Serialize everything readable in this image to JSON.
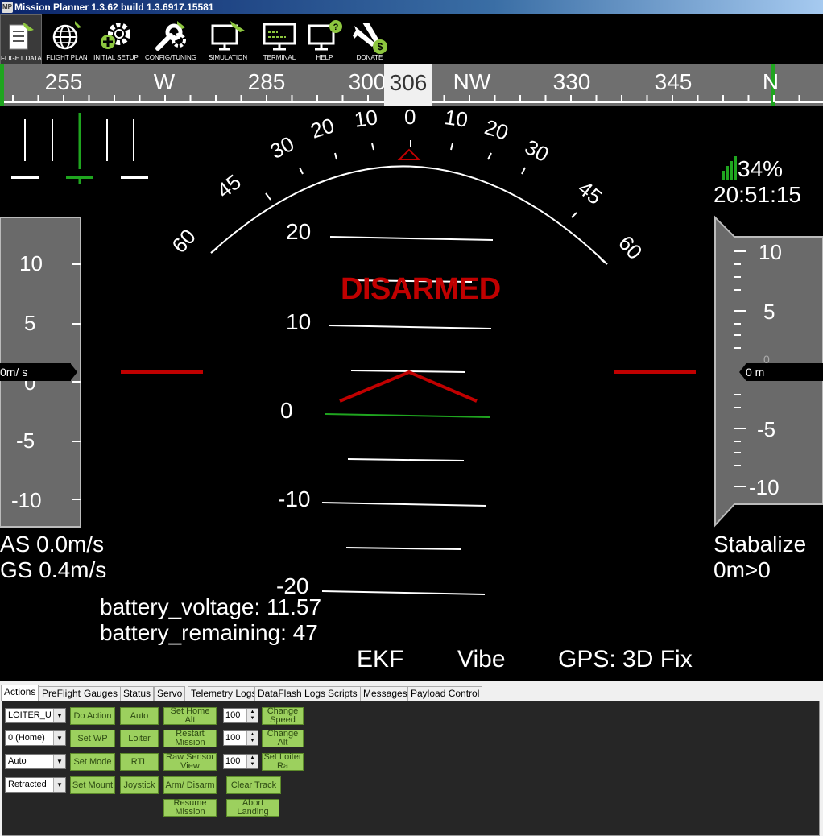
{
  "window": {
    "title": "Mission Planner 1.3.62 build 1.3.6917.15581"
  },
  "toolbar": [
    {
      "label": "FLIGHT DATA",
      "icon": "flight-data-icon"
    },
    {
      "label": "FLIGHT PLAN",
      "icon": "flight-plan-icon"
    },
    {
      "label": "INITIAL SETUP",
      "icon": "initial-setup-icon"
    },
    {
      "label": "CONFIG/TUNING",
      "icon": "config-tuning-icon"
    },
    {
      "label": "SIMULATION",
      "icon": "simulation-icon"
    },
    {
      "label": "TERMINAL",
      "icon": "terminal-icon"
    },
    {
      "label": "HELP",
      "icon": "help-icon"
    },
    {
      "label": "DONATE",
      "icon": "donate-icon"
    }
  ],
  "heading": {
    "labels": [
      "255",
      "W",
      "285",
      "300",
      "NW",
      "330",
      "345",
      "N"
    ],
    "current": "306"
  },
  "hud": {
    "roll_scale": [
      "60",
      "45",
      "30",
      "20",
      "10",
      "0",
      "10",
      "20",
      "30",
      "45",
      "60"
    ],
    "pitch_scale": [
      "20",
      "10",
      "0",
      "-10",
      "-20"
    ],
    "status": "DISARMED",
    "battery_pct": "34%",
    "clock": "20:51:15",
    "speed_scale": [
      "10",
      "5",
      "0",
      "-5",
      "-10"
    ],
    "speed_readout": "0m/ s",
    "alt_scale": [
      "10",
      "5",
      "0",
      "-5",
      "-10"
    ],
    "alt_readout": "0 m",
    "airspeed": "AS 0.0m/s",
    "groundspeed": "GS 0.4m/s",
    "battery_voltage": "battery_voltage: 11.57",
    "battery_remaining": "battery_remaining: 47",
    "mode": "Stabalize",
    "wp_dist": "0m>0",
    "ekf": "EKF",
    "vibe": "Vibe",
    "gps": "GPS: 3D Fix"
  },
  "tabs": [
    "Actions",
    "PreFlight",
    "Gauges",
    "Status",
    "Servo",
    "Telemetry Logs",
    "DataFlash Logs",
    "Scripts",
    "Messages",
    "Payload Control"
  ],
  "actions": {
    "combos": [
      "LOITER_U",
      "0 (Home)",
      "Auto",
      "Retracted"
    ],
    "buttons": {
      "do_action": "Do Action",
      "auto": "Auto",
      "set_home_alt": "Set Home Alt",
      "change_speed": "Change Speed",
      "set_wp": "Set WP",
      "loiter": "Loiter",
      "restart_mission": "Restart Mission",
      "change_alt": "Change Alt",
      "set_mode": "Set Mode",
      "rtl": "RTL",
      "raw_sensor_view": "Raw Sensor View",
      "set_loiter_rad": "Set Loiter Ra",
      "set_mount": "Set Mount",
      "joystick": "Joystick",
      "arm_disarm": "Arm/ Disarm",
      "clear_track": "Clear Track",
      "resume_mission": "Resume Mission",
      "abort_landing": "Abort Landing"
    },
    "numerics": [
      "100",
      "100",
      "100"
    ]
  },
  "colors": {
    "accent_green": "#9cd05e",
    "disarmed_red": "#c00000",
    "hud_bg": "#000000",
    "tape_gray": "#6a6a6a"
  }
}
